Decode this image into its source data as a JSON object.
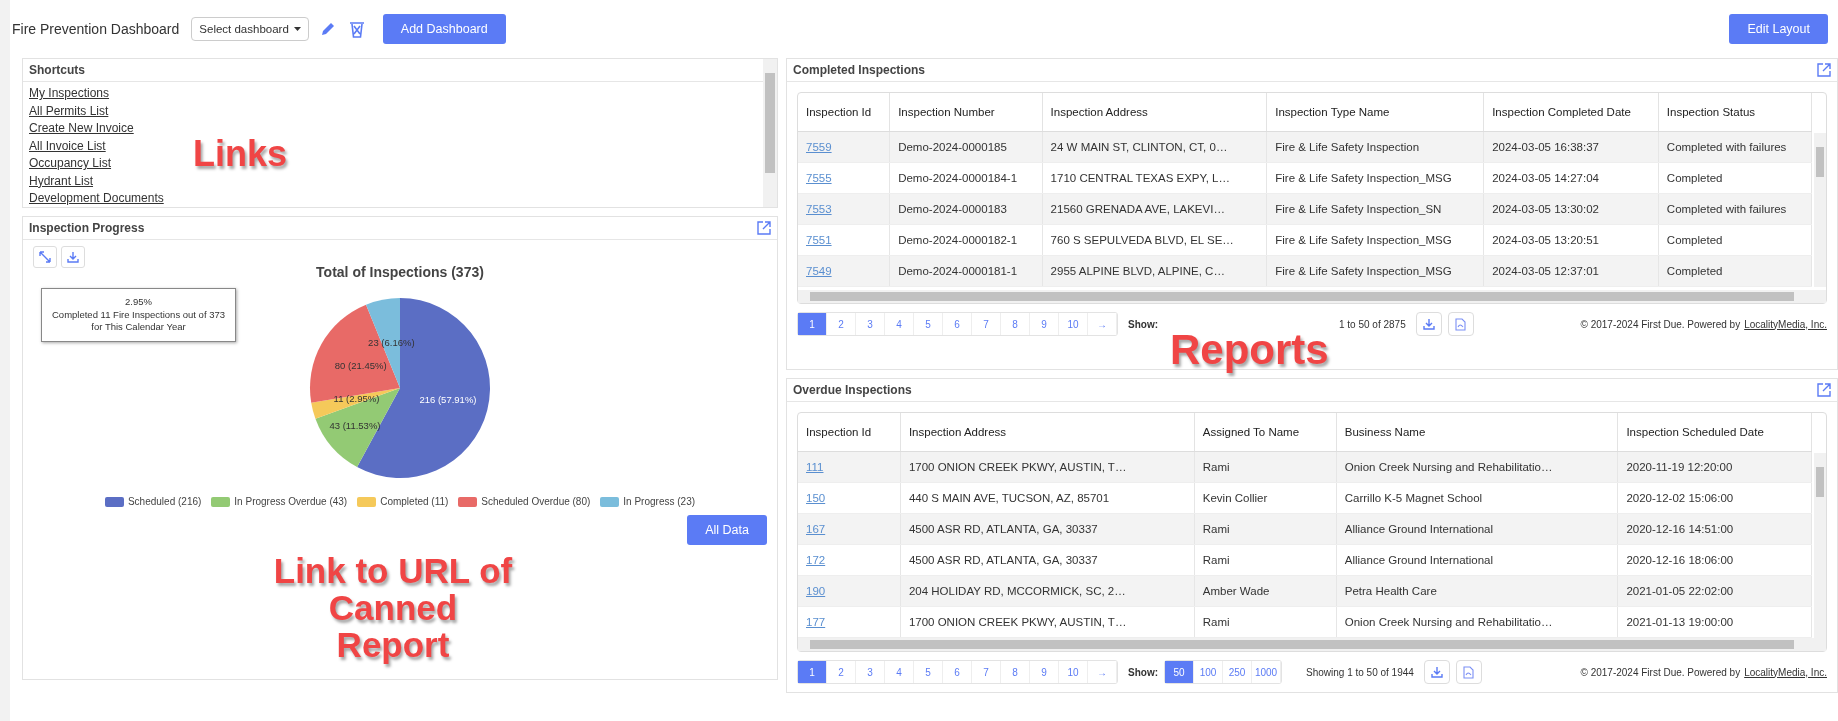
{
  "header": {
    "title": "Fire Prevention Dashboard",
    "dashboard_select": "Select dashboard",
    "add_button": "Add Dashboard",
    "edit_button": "Edit Layout"
  },
  "shortcuts": {
    "title": "Shortcuts",
    "links": [
      "My Inspections",
      "All Permits List",
      "Create New Invoice",
      "All Invoice List",
      "Occupancy List",
      "Hydrant List",
      "Development Documents"
    ]
  },
  "progress": {
    "title": "Inspection Progress",
    "tooltip": [
      "2.95%",
      "Completed 11 Fire Inspections out of 373",
      "for This Calendar Year"
    ],
    "chart_data": {
      "type": "pie",
      "title": "Total of Inspections (373)",
      "values": [
        57.91,
        11.53,
        2.95,
        21.45,
        6.16
      ],
      "value_labels": [
        "216 (57.91%)",
        "43 (11.53%)",
        "11 (2.95%)",
        "80 (21.45%)",
        "23 (6.16%)"
      ]
    },
    "legend": [
      {
        "label": "Scheduled (216)",
        "color": "#5b6ec4"
      },
      {
        "label": "In Progress Overdue (43)",
        "color": "#93ca74"
      },
      {
        "label": "Completed (11)",
        "color": "#f5c95a"
      },
      {
        "label": "Scheduled Overdue (80)",
        "color": "#e86a67"
      },
      {
        "label": "In Progress (23)",
        "color": "#7bbddc"
      }
    ],
    "all_data_button": "All Data"
  },
  "completed": {
    "title": "Completed Inspections",
    "columns": [
      "Inspection Id",
      "Inspection Number",
      "Inspection Address",
      "Inspection Type Name",
      "Inspection Completed Date",
      "Inspection Status"
    ],
    "rows": [
      [
        "7559",
        "Demo-2024-0000185",
        "24 W MAIN ST, CLINTON, CT, 0…",
        "Fire & Life Safety Inspection",
        "2024-03-05 16:38:37",
        "Completed with failures"
      ],
      [
        "7555",
        "Demo-2024-0000184-1",
        "1710 CENTRAL TEXAS EXPY, L…",
        "Fire & Life Safety Inspection_MSG",
        "2024-03-05 14:27:04",
        "Completed"
      ],
      [
        "7553",
        "Demo-2024-0000183",
        "21560 GRENADA AVE, LAKEVI…",
        "Fire & Life Safety Inspection_SN",
        "2024-03-05 13:30:02",
        "Completed with failures"
      ],
      [
        "7551",
        "Demo-2024-0000182-1",
        "760 S SEPULVEDA BLVD, EL SE…",
        "Fire & Life Safety Inspection_MSG",
        "2024-03-05 13:20:51",
        "Completed"
      ],
      [
        "7549",
        "Demo-2024-0000181-1",
        "2955 ALPINE BLVD, ALPINE, C…",
        "Fire & Life Safety Inspection_MSG",
        "2024-03-05 12:37:01",
        "Completed"
      ]
    ],
    "pager": {
      "pages": [
        {
          "label": "1",
          "selected": true
        },
        {
          "label": "2",
          "selected": false
        },
        {
          "label": "3",
          "selected": false
        },
        {
          "label": "4",
          "selected": false
        },
        {
          "label": "5",
          "selected": false
        },
        {
          "label": "6",
          "selected": false
        },
        {
          "label": "7",
          "selected": false
        },
        {
          "label": "8",
          "selected": false
        },
        {
          "label": "9",
          "selected": false
        },
        {
          "label": "10",
          "selected": false
        },
        {
          "label": "→",
          "selected": false
        }
      ],
      "show_label": "Show:",
      "info": "1 to 50 of 2875"
    },
    "copyright": "© 2017-2024 First Due. Powered by",
    "copyright_link": "LocalityMedia, Inc."
  },
  "overdue": {
    "title": "Overdue Inspections",
    "columns": [
      "Inspection Id",
      "Inspection Address",
      "Assigned To Name",
      "Business Name",
      "Inspection Scheduled Date"
    ],
    "rows": [
      [
        "111",
        "1700 ONION CREEK PKWY, AUSTIN, T…",
        "Rami",
        "Onion Creek Nursing and Rehabilitatio…",
        "2020-11-19 12:20:00"
      ],
      [
        "150",
        "440 S MAIN AVE, TUCSON, AZ, 85701",
        "Kevin Collier",
        "Carrillo K-5 Magnet School",
        "2020-12-02 15:06:00"
      ],
      [
        "167",
        "4500 ASR RD, ATLANTA, GA, 30337",
        "Rami",
        "Alliance Ground International",
        "2020-12-16 14:51:00"
      ],
      [
        "172",
        "4500 ASR RD, ATLANTA, GA, 30337",
        "Rami",
        "Alliance Ground International",
        "2020-12-16 18:06:00"
      ],
      [
        "190",
        "204 HOLIDAY RD, MCCORMICK, SC, 2…",
        "Amber Wade",
        "Petra Health Care",
        "2021-01-05 22:02:00"
      ],
      [
        "177",
        "1700 ONION CREEK PKWY, AUSTIN, T…",
        "Rami",
        "Onion Creek Nursing and Rehabilitatio…",
        "2021-01-13 19:00:00"
      ]
    ],
    "pager": {
      "pages": [
        {
          "label": "1",
          "selected": true
        },
        {
          "label": "2",
          "selected": false
        },
        {
          "label": "3",
          "selected": false
        },
        {
          "label": "4",
          "selected": false
        },
        {
          "label": "5",
          "selected": false
        },
        {
          "label": "6",
          "selected": false
        },
        {
          "label": "7",
          "selected": false
        },
        {
          "label": "8",
          "selected": false
        },
        {
          "label": "9",
          "selected": false
        },
        {
          "label": "10",
          "selected": false
        },
        {
          "label": "→",
          "selected": false
        }
      ],
      "show_label": "Show:",
      "show_options": [
        {
          "label": "50",
          "selected": true
        },
        {
          "label": "100",
          "selected": false
        },
        {
          "label": "250",
          "selected": false
        },
        {
          "label": "1000",
          "selected": false
        }
      ],
      "info": "Showing 1 to 50 of 1944"
    },
    "copyright": "© 2017-2024 First Due. Powered by",
    "copyright_link": "LocalityMedia, Inc."
  },
  "annotations": [
    {
      "kind": "links",
      "text": "Links"
    },
    {
      "kind": "reports",
      "text": "Reports"
    },
    {
      "kind": "canned",
      "text": "Link to URL of Canned Report"
    }
  ]
}
